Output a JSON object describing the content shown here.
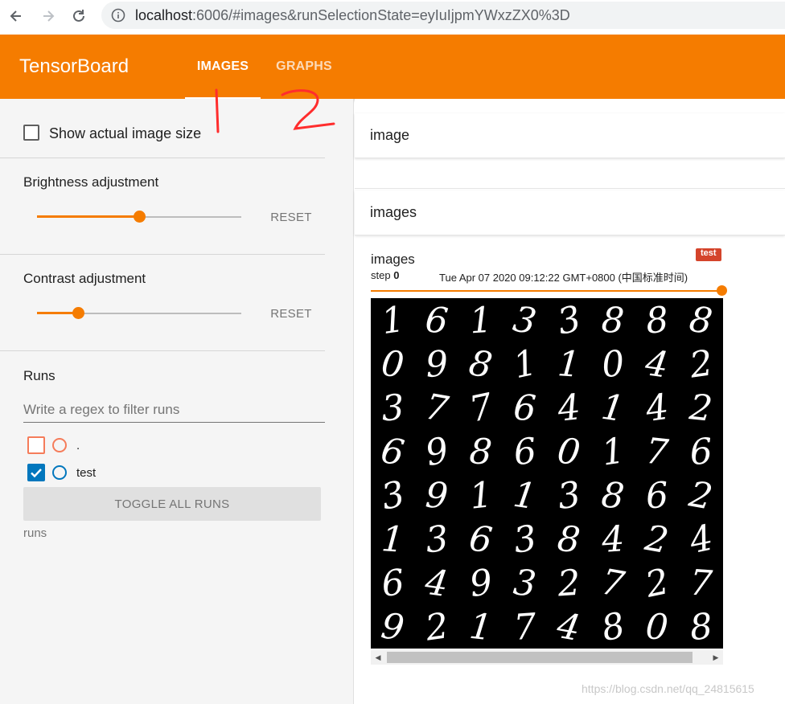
{
  "browser": {
    "url_host": "localhost",
    "url_rest": ":6006/#images&runSelectionState=eyIuIjpmYWxzZX0%3D"
  },
  "app": {
    "brand": "TensorBoard",
    "tabs": [
      {
        "label": "IMAGES",
        "active": true
      },
      {
        "label": "GRAPHS",
        "active": false
      }
    ],
    "accent": "#f57c00"
  },
  "sidebar": {
    "show_actual_size": {
      "label": "Show actual image size",
      "checked": false
    },
    "brightness": {
      "label": "Brightness adjustment",
      "value": 0.5,
      "reset": "RESET"
    },
    "contrast": {
      "label": "Contrast adjustment",
      "value": 0.2,
      "reset": "RESET"
    },
    "runs": {
      "title": "Runs",
      "filter_placeholder": "Write a regex to filter runs",
      "items": [
        {
          "name": ".",
          "checked": false,
          "color": "#f57c5a"
        },
        {
          "name": "test",
          "checked": true,
          "color": "#0277bd"
        }
      ],
      "toggle_all": "TOGGLE ALL RUNS",
      "caption": "runs"
    }
  },
  "main": {
    "groups": [
      {
        "title": "image"
      },
      {
        "title": "images"
      }
    ],
    "image_card": {
      "title": "images",
      "run_tag": "test",
      "run_tag_color": "#d4442b",
      "step_label": "step",
      "step_value": "0",
      "timestamp": "Tue Apr 07 2020 09:12:22 GMT+0800 (中国标准时间)",
      "digits": [
        [
          "1",
          "6",
          "1",
          "3",
          "3",
          "8",
          "8",
          "8"
        ],
        [
          "0",
          "9",
          "8",
          "1",
          "1",
          "0",
          "4",
          "2"
        ],
        [
          "3",
          "7",
          "7",
          "6",
          "4",
          "1",
          "4",
          "2"
        ],
        [
          "6",
          "9",
          "8",
          "6",
          "0",
          "1",
          "7",
          "6"
        ],
        [
          "3",
          "9",
          "1",
          "1",
          "3",
          "8",
          "6",
          "2"
        ],
        [
          "1",
          "3",
          "6",
          "3",
          "8",
          "4",
          "2",
          "4"
        ],
        [
          "6",
          "4",
          "9",
          "3",
          "2",
          "7",
          "2",
          "7"
        ],
        [
          "9",
          "2",
          "1",
          "7",
          "4",
          "8",
          "0",
          "8"
        ]
      ]
    }
  },
  "annotations": {
    "mark_1": "1",
    "mark_2": "2"
  },
  "watermark": "https://blog.csdn.net/qq_24815615"
}
